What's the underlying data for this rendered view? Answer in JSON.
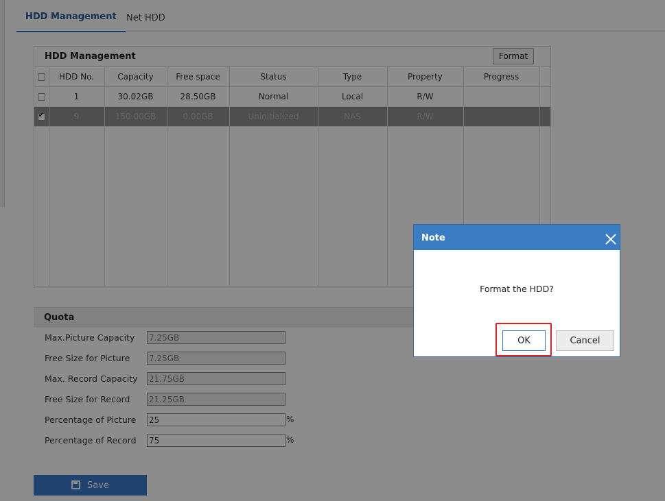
{
  "tabs": [
    {
      "label": "HDD Management",
      "active": true
    },
    {
      "label": "Net HDD",
      "active": false
    }
  ],
  "hdd_panel": {
    "title": "HDD Management",
    "format_label": "Format",
    "columns": [
      "HDD No.",
      "Capacity",
      "Free space",
      "Status",
      "Type",
      "Property",
      "Progress"
    ],
    "rows": [
      {
        "checked": false,
        "selected": false,
        "hdd_no": "1",
        "capacity": "30.02GB",
        "free_space": "28.50GB",
        "status": "Normal",
        "type": "Local",
        "property": "R/W",
        "progress": ""
      },
      {
        "checked": true,
        "selected": true,
        "hdd_no": "9",
        "capacity": "150.00GB",
        "free_space": "0.00GB",
        "status": "Uninitialized",
        "type": "NAS",
        "property": "R/W",
        "progress": ""
      }
    ]
  },
  "quota": {
    "title": "Quota",
    "fields": [
      {
        "label": "Max.Picture Capacity",
        "value": "7.25GB",
        "editable": false,
        "unit": ""
      },
      {
        "label": "Free Size for Picture",
        "value": "7.25GB",
        "editable": false,
        "unit": ""
      },
      {
        "label": "Max. Record Capacity",
        "value": "21.75GB",
        "editable": false,
        "unit": ""
      },
      {
        "label": "Free Size for Record",
        "value": "21.25GB",
        "editable": false,
        "unit": ""
      },
      {
        "label": "Percentage of Picture",
        "value": "25",
        "editable": true,
        "unit": "%"
      },
      {
        "label": "Percentage of Record",
        "value": "75",
        "editable": true,
        "unit": "%"
      }
    ]
  },
  "save_label": "Save",
  "dialog": {
    "title": "Note",
    "message": "Format the HDD?",
    "ok_label": "OK",
    "cancel_label": "Cancel"
  },
  "colors": {
    "accent": "#3b7dc2",
    "highlight": "#e02020"
  },
  "icons": {
    "close": "close-icon",
    "save": "save-icon"
  }
}
